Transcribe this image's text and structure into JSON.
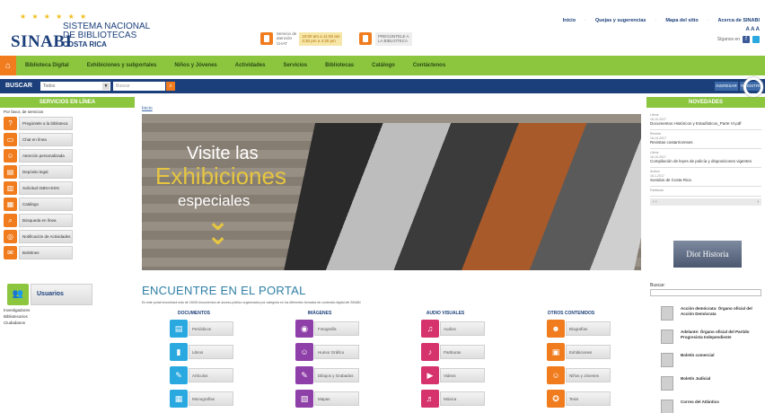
{
  "header": {
    "logo": {
      "sinabi": "SINABI",
      "line1": "SISTEMA NACIONAL",
      "line2": "DE BIBLIOTECAS",
      "line3": "COSTA RICA"
    },
    "promo1": {
      "text1": "Servicio de",
      "text2": "atención",
      "text3": "CHAT",
      "hours1": "10:00 am a 11:00 am",
      "hours2": "3:30 pm a 4:30 pm"
    },
    "promo2": {
      "text1": "PREGÚNTELE A",
      "text2": "LA BIBLIOTECA"
    },
    "toplinks": [
      "Inicio",
      "Quejas y sugerencias",
      "Mapa del sitio",
      "Acerca de SINABI"
    ],
    "fontsize": "A A A",
    "social_label": "Síganos en"
  },
  "nav": {
    "items": [
      "Biblioteca Digital",
      "Exhibiciones y subportales",
      "Niños y Jóvenes",
      "Actividades",
      "Servicios",
      "Bibliotecas",
      "Catálogo",
      "Contáctenos"
    ]
  },
  "searchbar": {
    "label": "BUSCAR",
    "select_value": "Todos",
    "input_placeholder": "Buscar",
    "btn_ingresar": "INGRESAR",
    "btn_registro": "REGISTRO"
  },
  "left": {
    "title": "SERVICIOS EN LÍNEA",
    "subtitle": "Por favor, de servicios",
    "services": [
      {
        "label": "Pregúntele a la biblioteca",
        "icon": "question-icon"
      },
      {
        "label": "Chat en línea",
        "icon": "chat-icon"
      },
      {
        "label": "Atención personalizada",
        "icon": "person-icon"
      },
      {
        "label": "Depósito legal",
        "icon": "document-icon"
      },
      {
        "label": "Solicitud ISBN-ISSN",
        "icon": "barcode-icon"
      },
      {
        "label": "Catálogo",
        "icon": "catalog-icon"
      },
      {
        "label": "Búsqueda en línea",
        "icon": "search-icon"
      },
      {
        "label": "Notificación de Actividades",
        "icon": "bell-icon"
      },
      {
        "label": "Boletines",
        "icon": "newsletter-icon"
      }
    ],
    "users_title": "Usuarios",
    "users_list": [
      "Investigadores",
      "Bibliotecarios",
      "Ciudadanos"
    ]
  },
  "main": {
    "breadcrumb": "Inicio",
    "banner": {
      "line1": "Visite las",
      "line2": "Exhibiciones",
      "line3": "especiales"
    },
    "portal_title": "ENCUENTRE EN EL PORTAL",
    "portal_desc": "En este portal encontrará más de 15000 documentos de acceso público organizados por categoría en los diferentes formatos de contenido digital del SINABI",
    "columns": [
      {
        "title": "DOCUMENTOS",
        "items": [
          "Periódicos",
          "Libros",
          "Artículos",
          "Monografías"
        ]
      },
      {
        "title": "IMÁGENES",
        "items": [
          "Fotografía",
          "Humor Gráfico",
          "Dibujos y Grabados",
          "Mapas"
        ]
      },
      {
        "title": "AUDIO VISUALES",
        "items": [
          "Audios",
          "Partituras",
          "Videos",
          "Música"
        ]
      },
      {
        "title": "OTROS CONTENIDOS",
        "items": [
          "Biografías",
          "Exhibiciones",
          "Niños y Jóvenes",
          "Tesis"
        ]
      }
    ]
  },
  "right": {
    "title": "NOVEDADES",
    "news": [
      {
        "kind": "Libros",
        "date": "16-10-2017",
        "title": "Documentos Históricos y Estadísticos_Parte VI.pdf"
      },
      {
        "kind": "Revista",
        "date": "16-10-2017",
        "title": "Revistas costarricenses"
      },
      {
        "kind": "Libros",
        "date": "16-10-2017",
        "title": "Compilación de leyes de policía y disposiciones vigentes"
      },
      {
        "kind": "Audios",
        "date": "16-1-2017",
        "title": "Sonidos de Costa Rica"
      },
      {
        "kind": "Partituras",
        "date": "",
        "title": ""
      }
    ],
    "pager_prev": "‹ ‹",
    "pager_next": "›",
    "historia": "Diot Historia",
    "search_label": "Buscar:",
    "pubs": [
      "Acción demócrata: Órgano oficial del Acción Demócrata",
      "Adelante: Órgano oficial del Partido Progresista Independiente",
      "Boletín comercial",
      "Boletín Judicial",
      "Correo del Atlántico"
    ]
  },
  "colors": {
    "green": "#8cc63f",
    "navy": "#1b3f7a",
    "orange": "#f07c1e",
    "gold": "#e6c640"
  }
}
